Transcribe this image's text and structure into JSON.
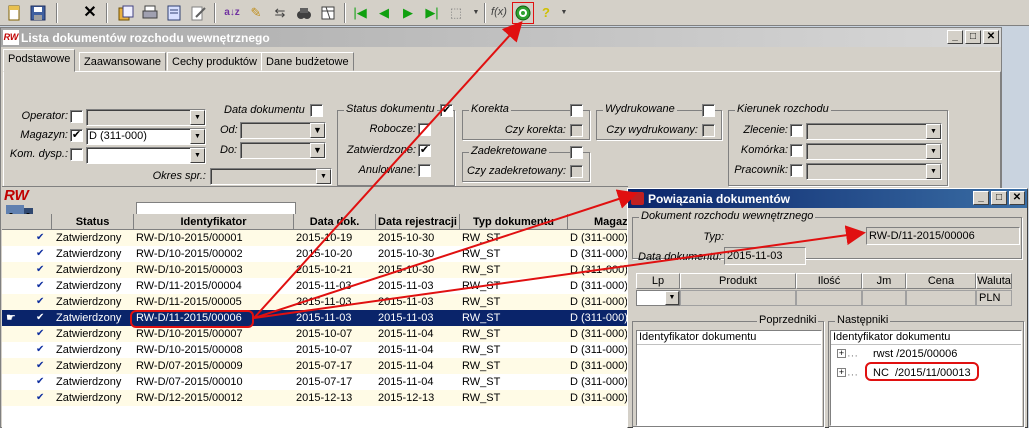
{
  "toolbar": {
    "icons": [
      "new-icon",
      "save-icon",
      "delete-icon",
      "copy-icon",
      "print-icon",
      "preview-icon",
      "edit-icon",
      "sort-icon",
      "pin-icon",
      "link-icon",
      "book-icon",
      "first-icon",
      "prev-icon",
      "next-icon",
      "last-icon",
      "export-icon",
      "formula-icon",
      "refresh-relations-icon",
      "wizard-icon"
    ],
    "formula_label": "f(x)"
  },
  "main_window": {
    "badge": "RW",
    "title": "Lista dokumentów rozchodu wewnętrznego",
    "tabs": [
      "Podstawowe",
      "Zaawansowane",
      "Cechy produktów",
      "Dane budżetowe"
    ]
  },
  "filters": {
    "operator_label": "Operator:",
    "magazyn_label": "Magazyn:",
    "magazyn_value": "D (311-000)",
    "kom_dysp_label": "Kom. dysp.:",
    "okres_label": "Okres spr.:",
    "data_dokumentu": {
      "title": "Data dokumentu",
      "od": "Od:",
      "do": "Do:"
    },
    "status_dokumentu": {
      "title": "Status dokumentu",
      "robocze": "Robocze:",
      "zatwierdzone": "Zatwierdzone:",
      "anulowane": "Anulowane:"
    },
    "korekta": {
      "title": "Korekta",
      "czy_korekta": "Czy korekta:"
    },
    "zadekretowane": {
      "title": "Zadekretowane",
      "czy_zadekretowany": "Czy zadekretowany:"
    },
    "wydrukowane": {
      "title": "Wydrukowane",
      "czy_wydrukowany": "Czy wydrukowany:"
    },
    "kierunek": {
      "title": "Kierunek rozchodu",
      "zlecenie": "Zlecenie:",
      "komorka": "Komórka:",
      "pracownik": "Pracownik:"
    }
  },
  "grid": {
    "logo": "RW",
    "columns": [
      "Status",
      "Identyfikator",
      "Data dok.",
      "Data rejestracji",
      "Typ dokumentu",
      "Magaz"
    ],
    "rows": [
      {
        "status": "Zatwierdzony",
        "id": "RW-D/10-2015/00001",
        "data_dok": "2015-10-19",
        "data_rej": "2015-10-30",
        "typ": "RW_ST",
        "mag": "D (311-000)"
      },
      {
        "status": "Zatwierdzony",
        "id": "RW-D/10-2015/00002",
        "data_dok": "2015-10-20",
        "data_rej": "2015-10-30",
        "typ": "RW_ST",
        "mag": "D (311-000)"
      },
      {
        "status": "Zatwierdzony",
        "id": "RW-D/10-2015/00003",
        "data_dok": "2015-10-21",
        "data_rej": "2015-10-30",
        "typ": "RW_ST",
        "mag": "D (311-000)"
      },
      {
        "status": "Zatwierdzony",
        "id": "RW-D/11-2015/00004",
        "data_dok": "2015-11-03",
        "data_rej": "2015-11-03",
        "typ": "RW_ST",
        "mag": "D (311-000)"
      },
      {
        "status": "Zatwierdzony",
        "id": "RW-D/11-2015/00005",
        "data_dok": "2015-11-03",
        "data_rej": "2015-11-03",
        "typ": "RW_ST",
        "mag": "D (311-000)"
      },
      {
        "status": "Zatwierdzony",
        "id": "RW-D/11-2015/00006",
        "data_dok": "2015-11-03",
        "data_rej": "2015-11-03",
        "typ": "RW_ST",
        "mag": "D (311-000)"
      },
      {
        "status": "Zatwierdzony",
        "id": "RW-D/10-2015/00007",
        "data_dok": "2015-10-07",
        "data_rej": "2015-11-04",
        "typ": "RW_ST",
        "mag": "D (311-000)"
      },
      {
        "status": "Zatwierdzony",
        "id": "RW-D/10-2015/00008",
        "data_dok": "2015-10-07",
        "data_rej": "2015-11-04",
        "typ": "RW_ST",
        "mag": "D (311-000)"
      },
      {
        "status": "Zatwierdzony",
        "id": "RW-D/07-2015/00009",
        "data_dok": "2015-07-17",
        "data_rej": "2015-11-04",
        "typ": "RW_ST",
        "mag": "D (311-000)"
      },
      {
        "status": "Zatwierdzony",
        "id": "RW-D/07-2015/00010",
        "data_dok": "2015-07-17",
        "data_rej": "2015-11-04",
        "typ": "RW_ST",
        "mag": "D (311-000)"
      },
      {
        "status": "Zatwierdzony",
        "id": "RW-D/12-2015/00012",
        "data_dok": "2015-12-13",
        "data_rej": "2015-12-13",
        "typ": "RW_ST",
        "mag": "D (311-000)"
      }
    ],
    "selected_index": 5
  },
  "dialog": {
    "title": "Powiązania dokumentów",
    "group_title": "Dokument rozchodu wewnętrznego",
    "typ_label": "Typ:",
    "typ_value": "RW-D/11-2015/00006",
    "data_label": "Data dokumentu:",
    "data_value": "2015-11-03",
    "columns": [
      "Lp",
      "Produkt",
      "Ilość",
      "Jm",
      "Cena",
      "Waluta"
    ],
    "waluta_value": "PLN",
    "poprzedniki": {
      "title": "Poprzedniki",
      "header": "Identyfikator dokumentu"
    },
    "nastepniki": {
      "title": "Następniki",
      "header": "Identyfikator dokumentu",
      "items": [
        "rwst /2015/00006",
        "NC  /2015/11/00013"
      ]
    }
  },
  "colors": {
    "title_active": "#0a246a",
    "selection": "#0a246a",
    "highlight": "#e01010",
    "row_alt": "#fffbe6"
  }
}
